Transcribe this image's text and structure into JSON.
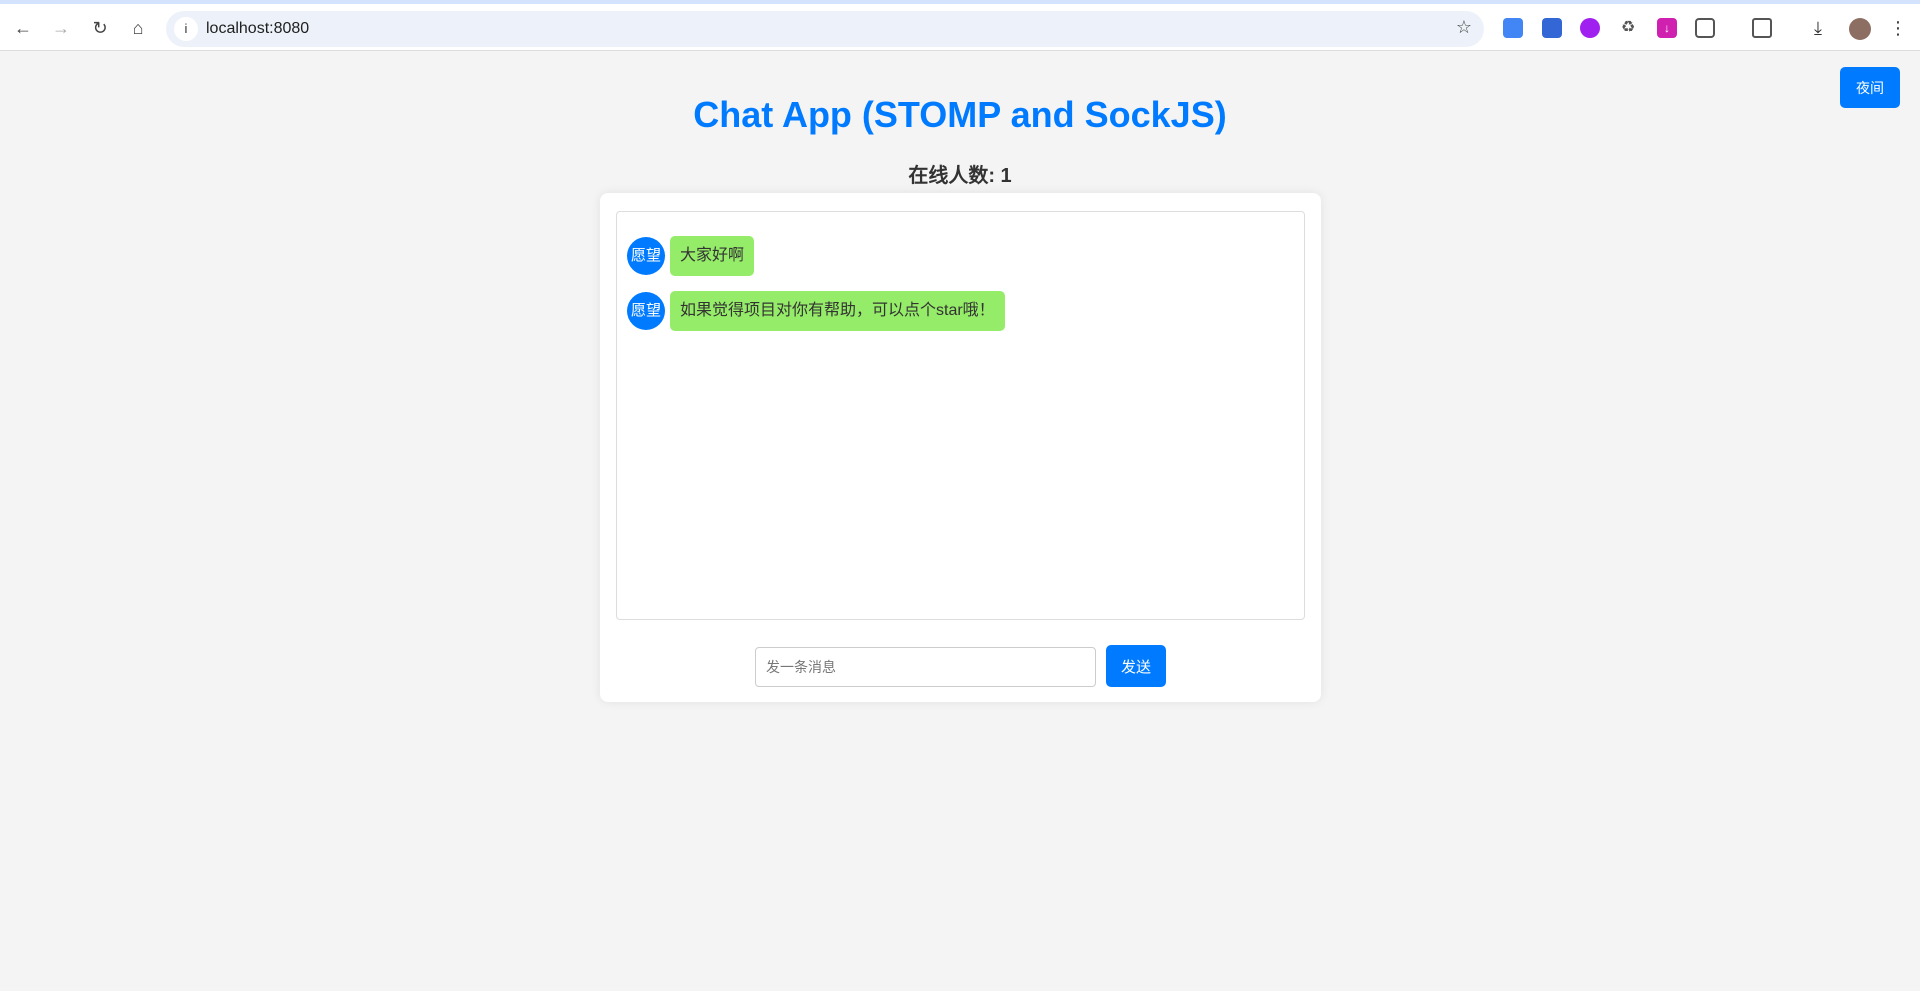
{
  "browser": {
    "url": "localhost:8080",
    "back_icon": "←",
    "forward_icon": "→",
    "reload_icon": "↻",
    "home_icon": "⌂"
  },
  "page": {
    "title": "Chat App (STOMP and SockJS)",
    "online_label": "在线人数: 1",
    "night_button": "夜间"
  },
  "messages": [
    {
      "avatar": "愿望",
      "text": "大家好啊"
    },
    {
      "avatar": "愿望",
      "text": "如果觉得项目对你有帮助，可以点个star哦！"
    }
  ],
  "composer": {
    "placeholder": "发一条消息",
    "value": "",
    "send_label": "发送"
  },
  "colors": {
    "accent": "#007bff",
    "bubble": "#95ec69"
  }
}
